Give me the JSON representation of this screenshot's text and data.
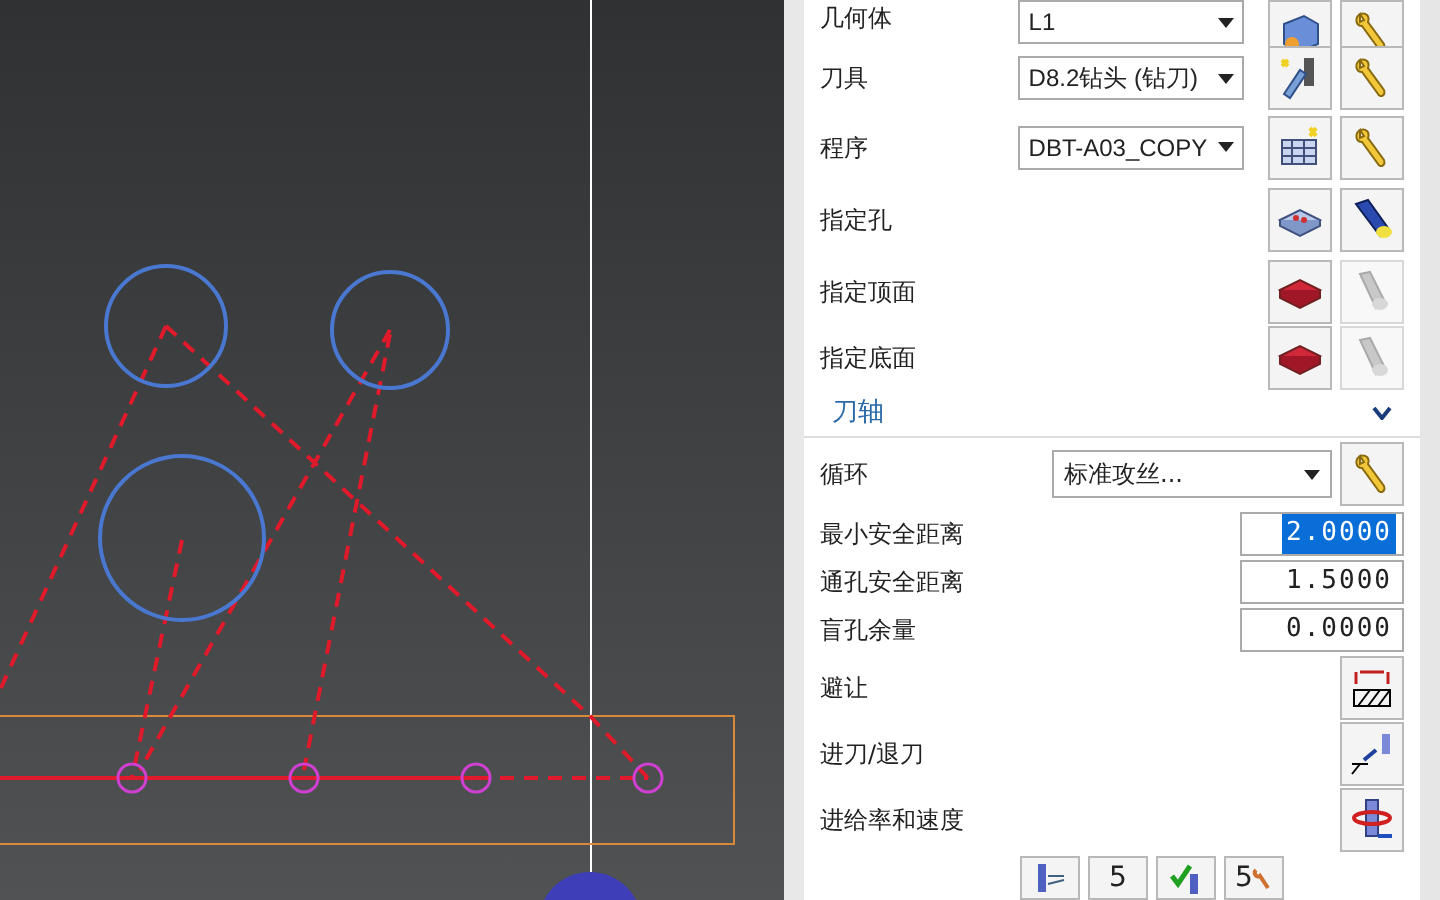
{
  "rows": [
    {
      "kind": "dropdown",
      "label": "几何体",
      "value": "L1",
      "buttons": [
        {
          "disabled": false
        },
        {
          "disabled": false
        }
      ]
    },
    {
      "kind": "dropdown",
      "label": "刀具",
      "value": "D8.2钻头 (钻刀)",
      "buttons": [
        {
          "disabled": false
        },
        {
          "disabled": false
        }
      ]
    },
    {
      "kind": "dropdown",
      "label": "程序",
      "value": "DBT-A03_COPY",
      "buttons": [
        {
          "disabled": false
        },
        {
          "disabled": false
        }
      ]
    },
    {
      "kind": "select",
      "label": "指定孔",
      "buttons": [
        {
          "disabled": false
        },
        {
          "disabled": false
        }
      ]
    },
    {
      "kind": "select",
      "label": "指定顶面",
      "buttons": [
        {
          "disabled": false
        },
        {
          "disabled": true
        }
      ]
    },
    {
      "kind": "select",
      "label": "指定底面",
      "buttons": [
        {
          "disabled": false
        },
        {
          "disabled": true
        }
      ]
    },
    {
      "kind": "section",
      "label": "刀轴",
      "expanded": false
    },
    {
      "kind": "cycle",
      "label": "循环",
      "value": "标准攻丝...",
      "buttons": [
        {
          "disabled": false
        }
      ]
    },
    {
      "kind": "number",
      "label": "最小安全距离",
      "value": "2.0000",
      "selected": true
    },
    {
      "kind": "number",
      "label": "通孔安全距离",
      "value": "1.5000",
      "selected": false
    },
    {
      "kind": "number",
      "label": "盲孔余量",
      "value": "0.0000",
      "selected": false
    },
    {
      "kind": "action",
      "label": "避让",
      "buttons": [
        {
          "disabled": false
        }
      ]
    },
    {
      "kind": "action",
      "label": "进刀/退刀",
      "buttons": [
        {
          "disabled": false
        }
      ]
    },
    {
      "kind": "action",
      "label": "进给率和速度",
      "buttons": [
        {
          "disabled": false
        }
      ]
    }
  ],
  "footer": [
    {
      "kind": "icon"
    },
    {
      "kind": "text",
      "label": "5"
    },
    {
      "kind": "icon"
    },
    {
      "kind": "text_icon",
      "label": "5"
    }
  ]
}
